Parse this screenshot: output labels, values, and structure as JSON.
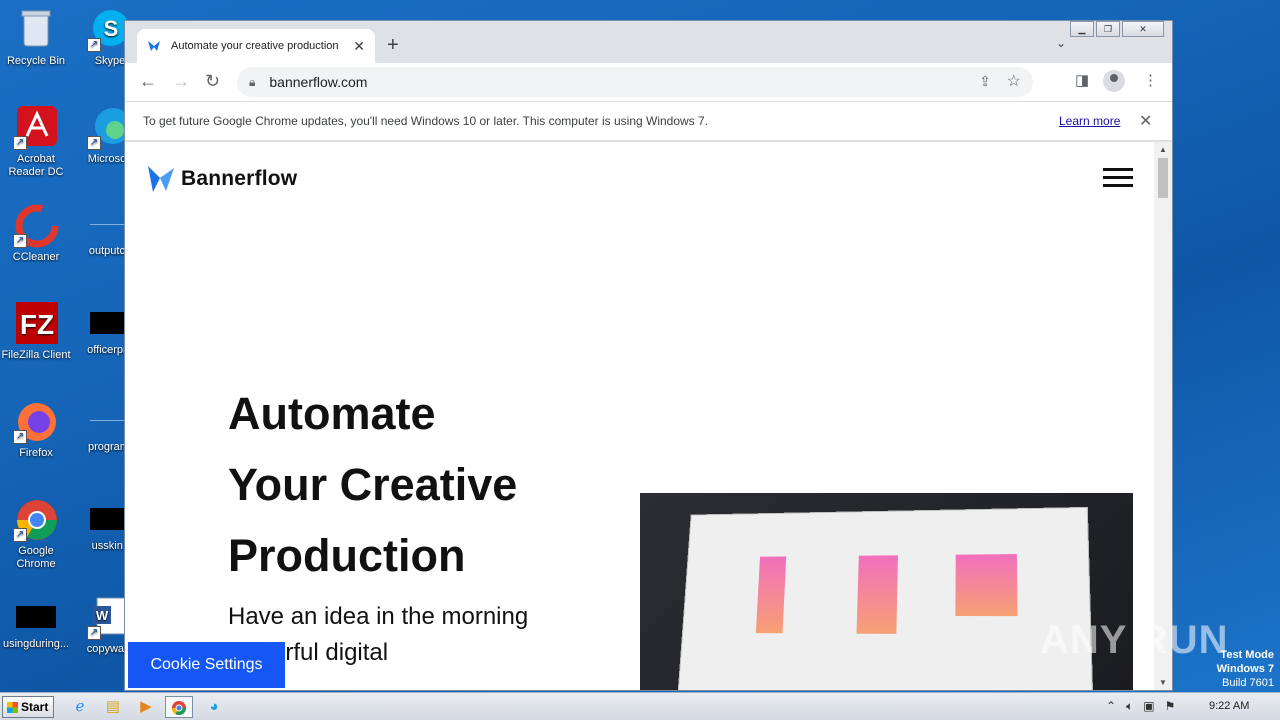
{
  "desktop": {
    "icons": [
      {
        "label": "Recycle Bin"
      },
      {
        "label": "Skype"
      },
      {
        "label": "Acrobat Reader DC"
      },
      {
        "label": "Microsoft"
      },
      {
        "label": "CCleaner"
      },
      {
        "label": "outputcd"
      },
      {
        "label": "FileZilla Client"
      },
      {
        "label": "officerpro"
      },
      {
        "label": "Firefox"
      },
      {
        "label": "programf"
      },
      {
        "label": "Google Chrome"
      },
      {
        "label": "usskin.j"
      },
      {
        "label": "usingduring..."
      },
      {
        "label": "copywant"
      }
    ]
  },
  "browser": {
    "tab_title": "Automate your creative production",
    "new_tab": "+",
    "url": "bannerflow.com",
    "infobar": {
      "message": "To get future Google Chrome updates, you'll need Windows 10 or later. This computer is using Windows 7.",
      "link": "Learn more"
    }
  },
  "page": {
    "brand": "Bannerflow",
    "hero_title_lines": [
      "Automate",
      "Your Creative",
      "Production"
    ],
    "hero_sub": "Have an idea in the morning powerful digital",
    "cookie_button": "Cookie Settings"
  },
  "watermark": {
    "anyrun": "ANY RUN",
    "line1": "Test Mode",
    "line2": "Windows 7",
    "line3": "Build 7601"
  },
  "taskbar": {
    "start": "Start",
    "clock": "9:22 AM"
  },
  "colors": {
    "accent": "#1457f5",
    "brand_blue": "#1a73e8"
  }
}
